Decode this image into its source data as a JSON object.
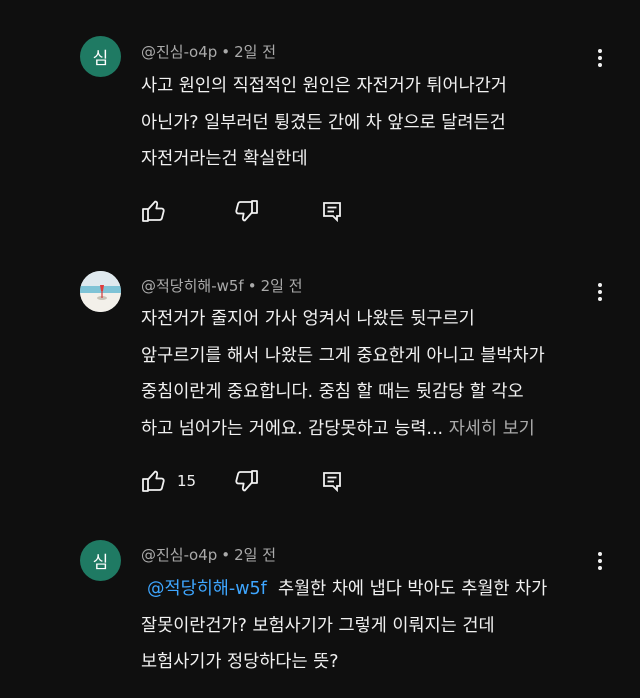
{
  "comments": [
    {
      "avatar_letter": "심",
      "author": "@진심-o4p",
      "time": "2일 전",
      "lines": [
        "사고 원인의 직접적인 원인은 자전거가 튀어나간거",
        "아닌가? 일부러던 튕겼든 간에 차 앞으로 달려든건",
        "자전거라는건 확실한데"
      ],
      "like_count": ""
    },
    {
      "avatar_letter": "",
      "author": "@적당히해-w5f",
      "time": "2일 전",
      "lines": [
        "자전거가 줄지어 가사 엉켜서 나왔든 뒷구르기",
        "앞구르기를 해서 나왔든 그게 중요한게 아니고 블박차가",
        "중침이란게 중요합니다. 중침 할 때는 뒷감당 할 각오",
        "하고 넘어가는 거에요. 감당못하고 능력"
      ],
      "ellipsis": "...",
      "read_more": "자세히 보기",
      "like_count": "15"
    },
    {
      "avatar_letter": "심",
      "author": "@진심-o4p",
      "time": "2일 전",
      "mention": "@적당히해-w5f",
      "lines": [
        "추월한 차에 냅다 박아도 추월한 차가",
        "잘못이란건가? 보험사기가 그렇게 이뤄지는 건데",
        "보험사기가 정당하다는 뜻?"
      ],
      "like_count": ""
    }
  ],
  "icons": {
    "like": "thumbs-up-icon",
    "dislike": "thumbs-down-icon",
    "reply": "reply-icon",
    "menu": "more-vert-icon"
  },
  "colors": {
    "background": "#0f0f0f",
    "avatar_green": "#1f7a63",
    "mention": "#3ea6ff",
    "secondary_text": "#aaaaaa"
  }
}
